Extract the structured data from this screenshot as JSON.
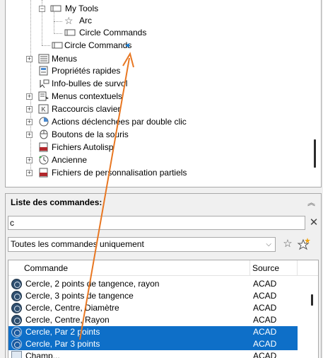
{
  "tree": {
    "items": [
      {
        "label": "My Tools",
        "icon": "toolbar-icon"
      },
      {
        "label": "Arc",
        "icon": "star-icon"
      },
      {
        "label": "Circle Commands",
        "icon": "toolbar-icon"
      },
      {
        "label": "Circle Commands",
        "icon": "toolbar-icon"
      },
      {
        "label": "Menus",
        "icon": "menu-icon"
      },
      {
        "label": "Propriétés rapides",
        "icon": "properties-icon"
      },
      {
        "label": "Info-bulles de survol",
        "icon": "tooltip-icon"
      },
      {
        "label": "Menus contextuels",
        "icon": "context-menu-icon"
      },
      {
        "label": "Raccourcis clavier",
        "icon": "keyboard-icon"
      },
      {
        "label": "Actions déclenchées par double clic",
        "icon": "double-click-icon"
      },
      {
        "label": "Boutons de la souris",
        "icon": "mouse-icon"
      },
      {
        "label": "Fichiers Autolisp",
        "icon": "lisp-file-icon"
      },
      {
        "label": "Ancienne",
        "icon": "legacy-icon"
      },
      {
        "label": "Fichiers de personnalisation partiels",
        "icon": "partial-cui-icon"
      }
    ],
    "insert_marker": "◄"
  },
  "commands_panel": {
    "title": "Liste des commandes:",
    "collapse_glyph": "︽",
    "search": {
      "value": "c",
      "clear_glyph": "✕"
    },
    "filter": {
      "selected": "Toutes les commandes uniquement",
      "chevron": "⌵"
    },
    "star_glyph": "☆",
    "table": {
      "headers": {
        "command": "Commande",
        "source": "Source"
      },
      "rows": [
        {
          "name": "Cercle, 2 points de tangence, rayon",
          "source": "ACAD",
          "selected": false,
          "icon": "circle-icon"
        },
        {
          "name": "Cercle, 3 points de tangence",
          "source": "ACAD",
          "selected": false,
          "icon": "circle-icon"
        },
        {
          "name": "Cercle, Centre, Diamètre",
          "source": "ACAD",
          "selected": false,
          "icon": "circle-icon"
        },
        {
          "name": "Cercle, Centre, Rayon",
          "source": "ACAD",
          "selected": false,
          "icon": "circle-icon"
        },
        {
          "name": "Cercle, Par 2 points",
          "source": "ACAD",
          "selected": true,
          "icon": "circle-icon"
        },
        {
          "name": "Cercle, Par 3 points",
          "source": "ACAD",
          "selected": true,
          "icon": "circle-icon"
        },
        {
          "name": "Champ...",
          "source": "ACAD",
          "selected": false,
          "icon": "field-icon"
        }
      ]
    }
  },
  "colors": {
    "selection": "#0e6fc8",
    "drag_arrow": "#e87722",
    "insert_marker": "#1a7fd6"
  }
}
